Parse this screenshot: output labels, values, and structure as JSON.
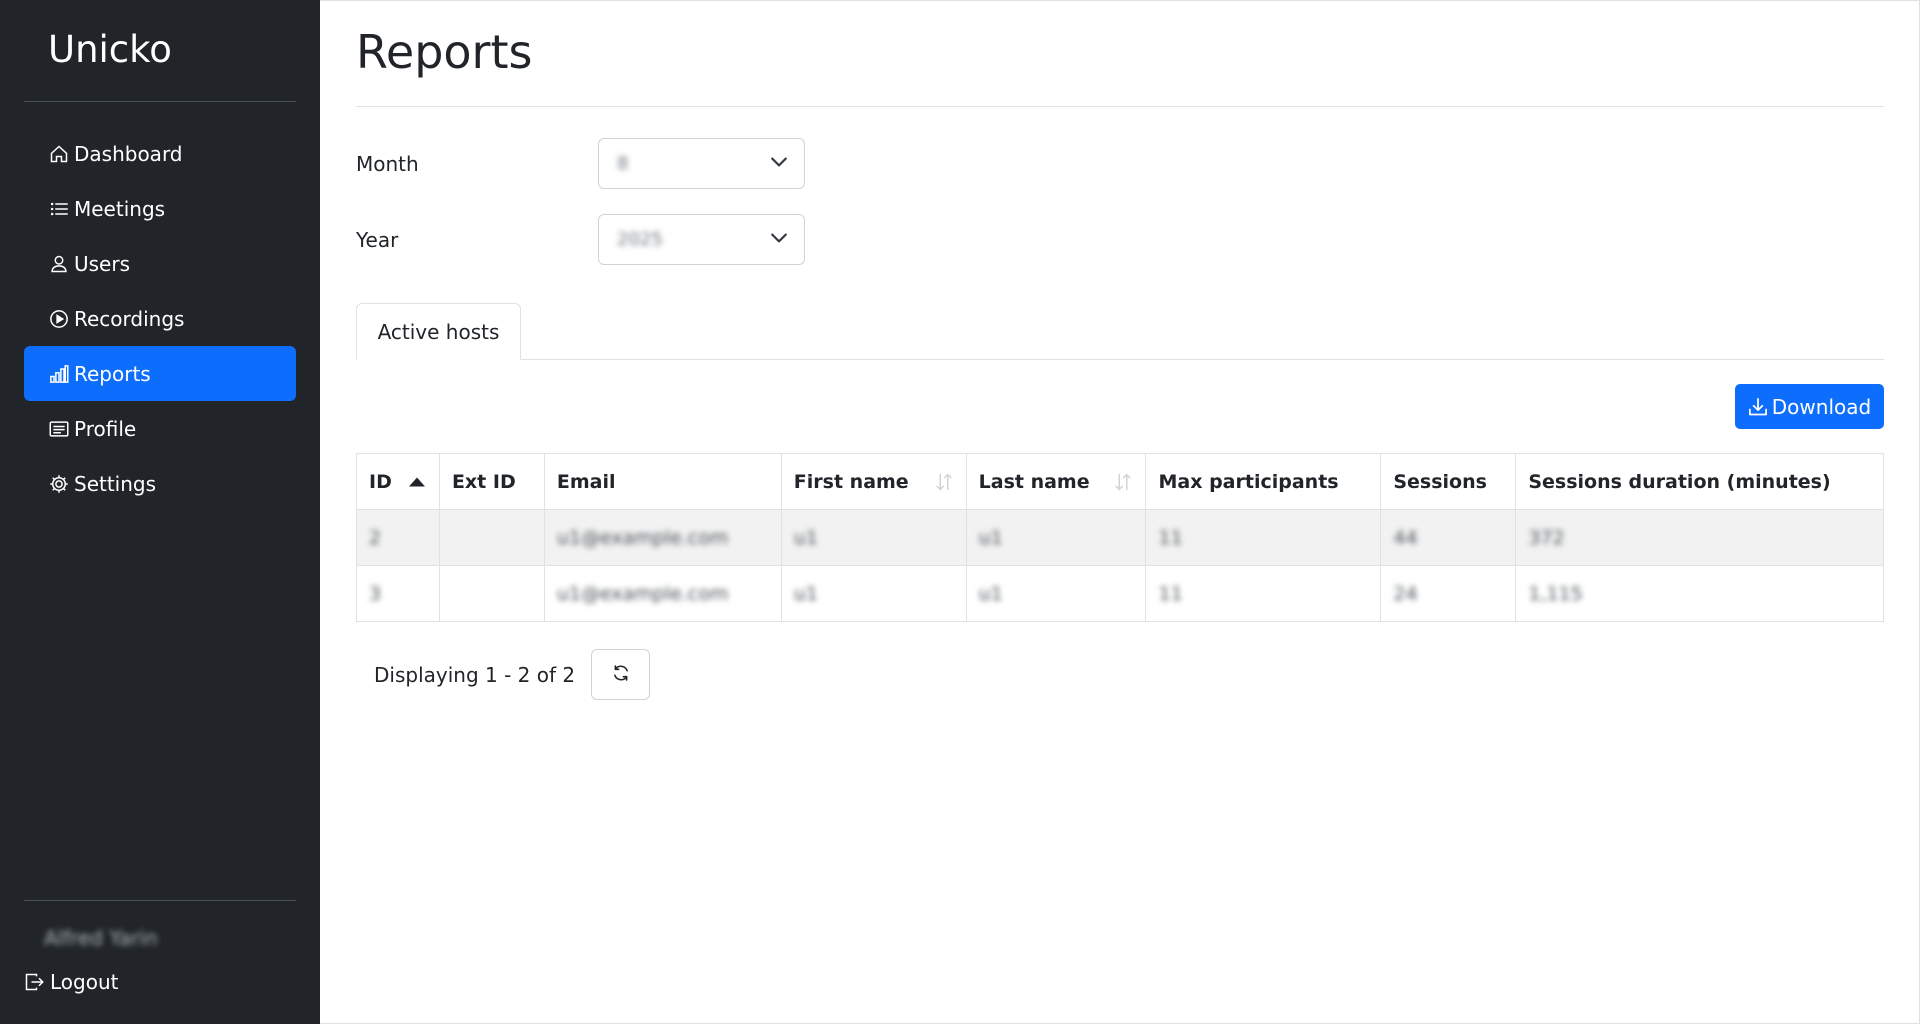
{
  "app": {
    "brand": "Unicko"
  },
  "sidebar": {
    "items": [
      {
        "label": "Dashboard",
        "icon": "house-icon",
        "active": false
      },
      {
        "label": "Meetings",
        "icon": "list-icon",
        "active": false
      },
      {
        "label": "Users",
        "icon": "person-icon",
        "active": false
      },
      {
        "label": "Recordings",
        "icon": "play-circle-icon",
        "active": false
      },
      {
        "label": "Reports",
        "icon": "bar-chart-icon",
        "active": true
      },
      {
        "label": "Profile",
        "icon": "card-text-icon",
        "active": false
      },
      {
        "label": "Settings",
        "icon": "gear-icon",
        "active": false
      }
    ],
    "user_name": "Alfred Yarin",
    "logout_label": "Logout"
  },
  "main": {
    "title": "Reports",
    "filters": {
      "month_label": "Month",
      "month_value": "8",
      "year_label": "Year",
      "year_value": "2025"
    },
    "tabs": [
      {
        "label": "Active hosts",
        "active": true
      }
    ],
    "download_label": "Download",
    "table": {
      "columns": [
        "ID",
        "Ext ID",
        "Email",
        "First name",
        "Last name",
        "Max participants",
        "Sessions",
        "Sessions duration (minutes)"
      ],
      "rows": [
        [
          "2",
          "",
          "u1@example.com",
          "u1",
          "u1",
          "11",
          "44",
          "372"
        ],
        [
          "3",
          "",
          "u1@example.com",
          "u1",
          "u1",
          "11",
          "24",
          "1,115"
        ]
      ]
    },
    "pager": {
      "info": "Displaying 1 - 2 of 2"
    }
  },
  "colors": {
    "sidebar_bg": "#212529",
    "accent": "#0d6efd"
  }
}
